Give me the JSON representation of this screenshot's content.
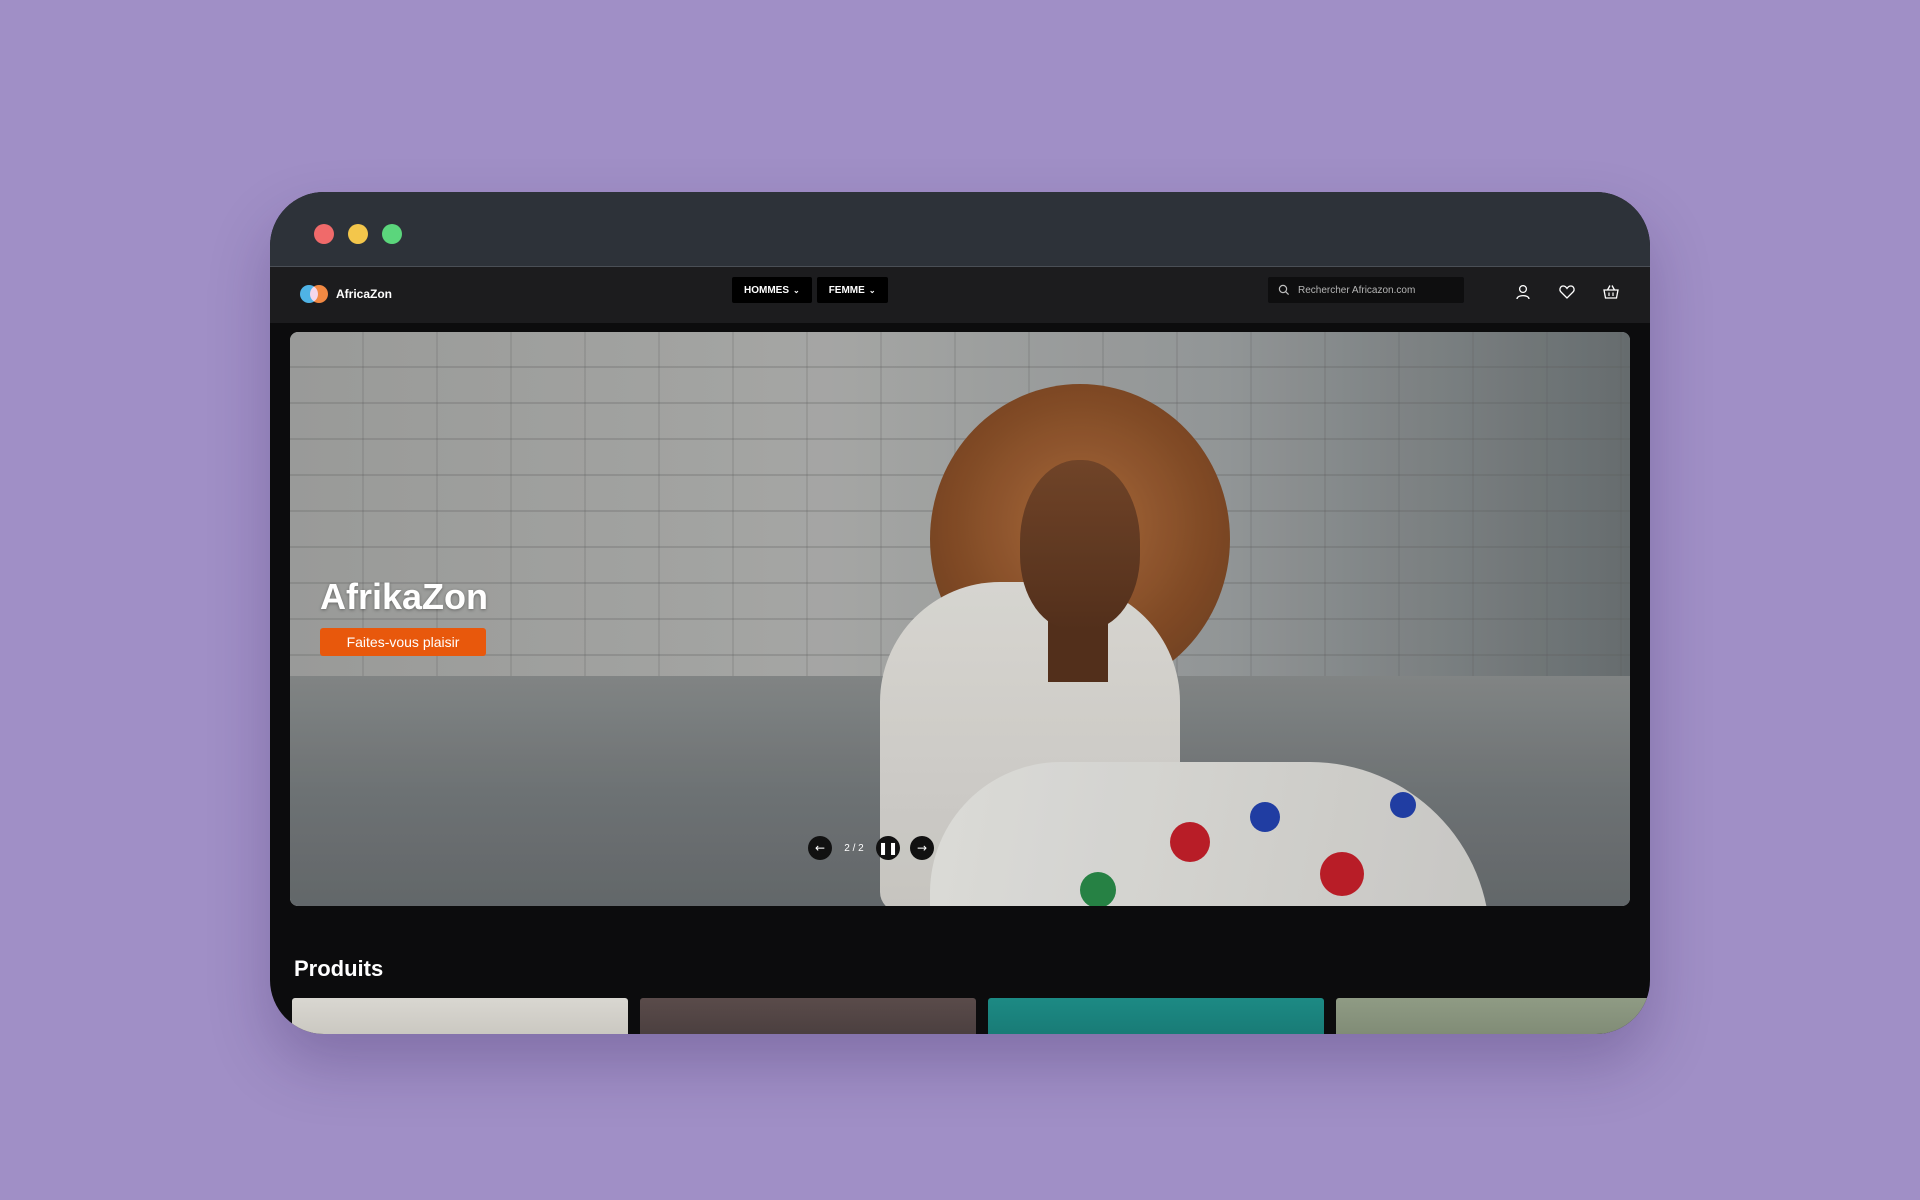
{
  "brand": {
    "name": "AfricaZon",
    "logo_colors": [
      "#4fb3e6",
      "#f07a2a"
    ]
  },
  "nav": {
    "menu": [
      {
        "label": "HOMMES",
        "icon": "chevron-down-icon"
      },
      {
        "label": "FEMME",
        "icon": "chevron-down-icon"
      }
    ],
    "search_placeholder": "Rechercher Africazon.com",
    "icons": [
      "user-icon",
      "heart-icon",
      "basket-icon"
    ]
  },
  "hero": {
    "title": "AfrikaZon",
    "cta": "Faites-vous plaisir",
    "cta_color": "#e8580c",
    "carousel": {
      "prev_icon": "arrow-left-icon",
      "counter": "2 / 2",
      "pause_icon": "pause-icon",
      "next_icon": "arrow-right-icon"
    }
  },
  "products": {
    "title": "Produits",
    "thumbnail_colors": [
      "#c7c5bf",
      "#4a4142",
      "#1f7f7a",
      "#7c8a72"
    ]
  },
  "colors": {
    "page_background": "#a08fc6",
    "titlebar": "#2d3239",
    "navbar": "#1c1c1e",
    "content": "#0c0c0d"
  }
}
